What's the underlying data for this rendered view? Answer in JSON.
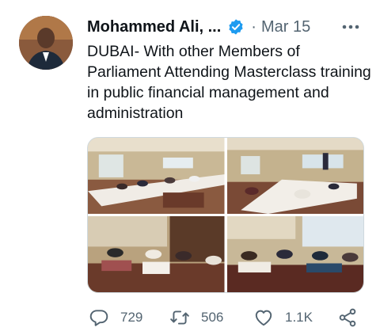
{
  "tweet": {
    "author_name": "Mohammed Ali, ...",
    "separator": "·",
    "date": "Mar 15",
    "text": "DUBAI- With other Members of Parliament Attending Masterclass training in public financial management and administration",
    "verified": true,
    "icons": {
      "verified": "verified-badge-icon",
      "more": "more-options-icon"
    }
  },
  "media": {
    "photo_count": 4
  },
  "actions": {
    "reply_count": "729",
    "retweet_count": "506",
    "like_count": "1.1K",
    "icons": [
      "reply-icon",
      "retweet-icon",
      "like-icon",
      "share-icon"
    ]
  },
  "colors": {
    "text_primary": "#0f1419",
    "text_secondary": "#536471",
    "verified_blue": "#1d9bf0",
    "icon_gray": "#536471"
  }
}
